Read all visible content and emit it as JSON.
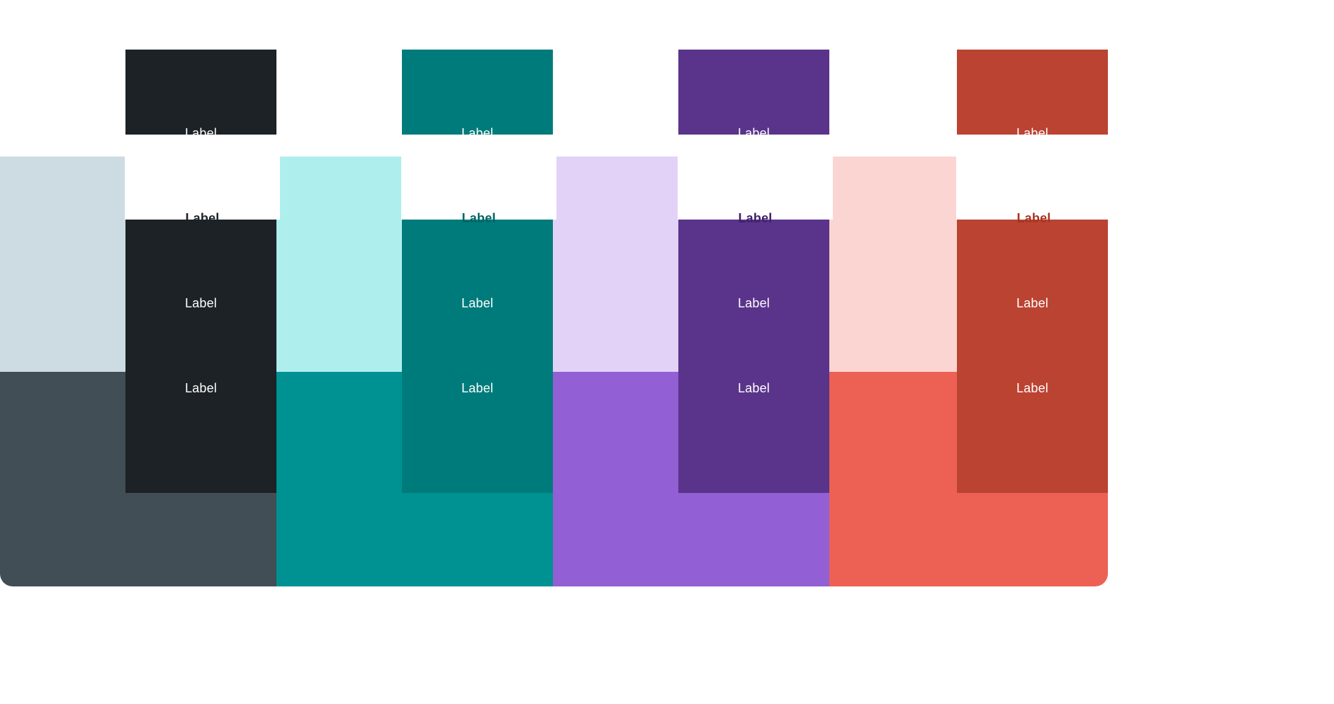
{
  "themes": [
    {
      "id": "neutral",
      "colors": {
        "rail": "#1c2226",
        "light_bg": "#cddce3",
        "dark_bg": "#424e56",
        "active_fg": "#1c2226"
      },
      "items": [
        {
          "label": "Label",
          "icon": "calendar-icon",
          "state": "default"
        },
        {
          "label": "Label",
          "icon": "calendar-icon",
          "state": "active"
        },
        {
          "label": "Label",
          "icon": "calendar-icon",
          "state": "default"
        },
        {
          "label": "Label",
          "icon": "calendar-icon",
          "state": "default"
        }
      ]
    },
    {
      "id": "teal",
      "colors": {
        "rail": "#007b7b",
        "light_bg": "#aeefee",
        "dark_bg": "#009292",
        "active_fg": "#006464"
      },
      "items": [
        {
          "label": "Label",
          "icon": "calendar-icon",
          "state": "default"
        },
        {
          "label": "Label",
          "icon": "calendar-icon",
          "state": "active"
        },
        {
          "label": "Label",
          "icon": "calendar-icon",
          "state": "default"
        },
        {
          "label": "Label",
          "icon": "calendar-icon",
          "state": "default"
        }
      ]
    },
    {
      "id": "purple",
      "colors": {
        "rail": "#5a348b",
        "light_bg": "#e2d2f8",
        "dark_bg": "#925fd4",
        "active_fg": "#3f1f6a"
      },
      "items": [
        {
          "label": "Label",
          "icon": "calendar-icon",
          "state": "default"
        },
        {
          "label": "Label",
          "icon": "calendar-icon",
          "state": "active"
        },
        {
          "label": "Label",
          "icon": "calendar-icon",
          "state": "default"
        },
        {
          "label": "Label",
          "icon": "calendar-icon",
          "state": "default"
        }
      ]
    },
    {
      "id": "red",
      "colors": {
        "rail": "#bb4331",
        "light_bg": "#fbd5d1",
        "dark_bg": "#ed6155",
        "active_fg": "#a73322"
      },
      "items": [
        {
          "label": "Label",
          "icon": "calendar-icon",
          "state": "default"
        },
        {
          "label": "Label",
          "icon": "calendar-icon",
          "state": "active"
        },
        {
          "label": "Label",
          "icon": "calendar-icon",
          "state": "default"
        },
        {
          "label": "Label",
          "icon": "calendar-icon",
          "state": "default"
        }
      ]
    }
  ]
}
